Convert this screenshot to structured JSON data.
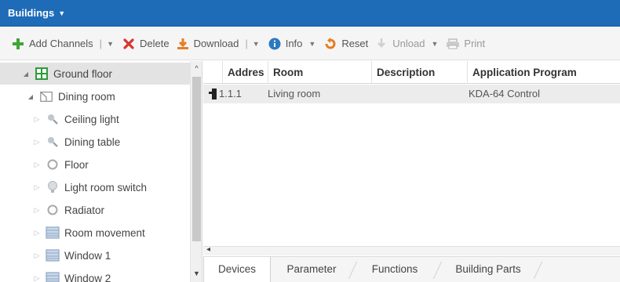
{
  "title_bar": {
    "title": "Buildings"
  },
  "toolbar": {
    "add_channels": "Add Channels",
    "delete": "Delete",
    "download": "Download",
    "info": "Info",
    "reset": "Reset",
    "unload": "Unload",
    "print": "Print"
  },
  "tree": {
    "root": "Ground floor",
    "room": "Dining room",
    "children": [
      {
        "label": "Ceiling light",
        "icon": "lamp-icon"
      },
      {
        "label": "Dining table",
        "icon": "lamp-icon"
      },
      {
        "label": "Floor",
        "icon": "circle-icon"
      },
      {
        "label": "Light room switch",
        "icon": "bulb-icon"
      },
      {
        "label": "Radiator",
        "icon": "circle-icon"
      },
      {
        "label": "Room movement",
        "icon": "window-icon"
      },
      {
        "label": "Window 1",
        "icon": "window-icon"
      },
      {
        "label": "Window 2",
        "icon": "window-icon"
      }
    ]
  },
  "grid": {
    "columns": [
      "Addres",
      "Room",
      "Description",
      "Application Program"
    ],
    "rows": [
      {
        "address": "1.1.1",
        "room": "Living room",
        "description": "",
        "program": "KDA-64 Control"
      }
    ]
  },
  "tabs": [
    "Devices",
    "Parameter",
    "Functions",
    "Building Parts"
  ],
  "colors": {
    "title_bar": "#1e6bb8",
    "add_icon": "#3fa535",
    "delete_icon": "#d9342b",
    "download_icon": "#e67e22",
    "info_icon": "#2a7ac0",
    "reset_icon": "#e67e22"
  }
}
